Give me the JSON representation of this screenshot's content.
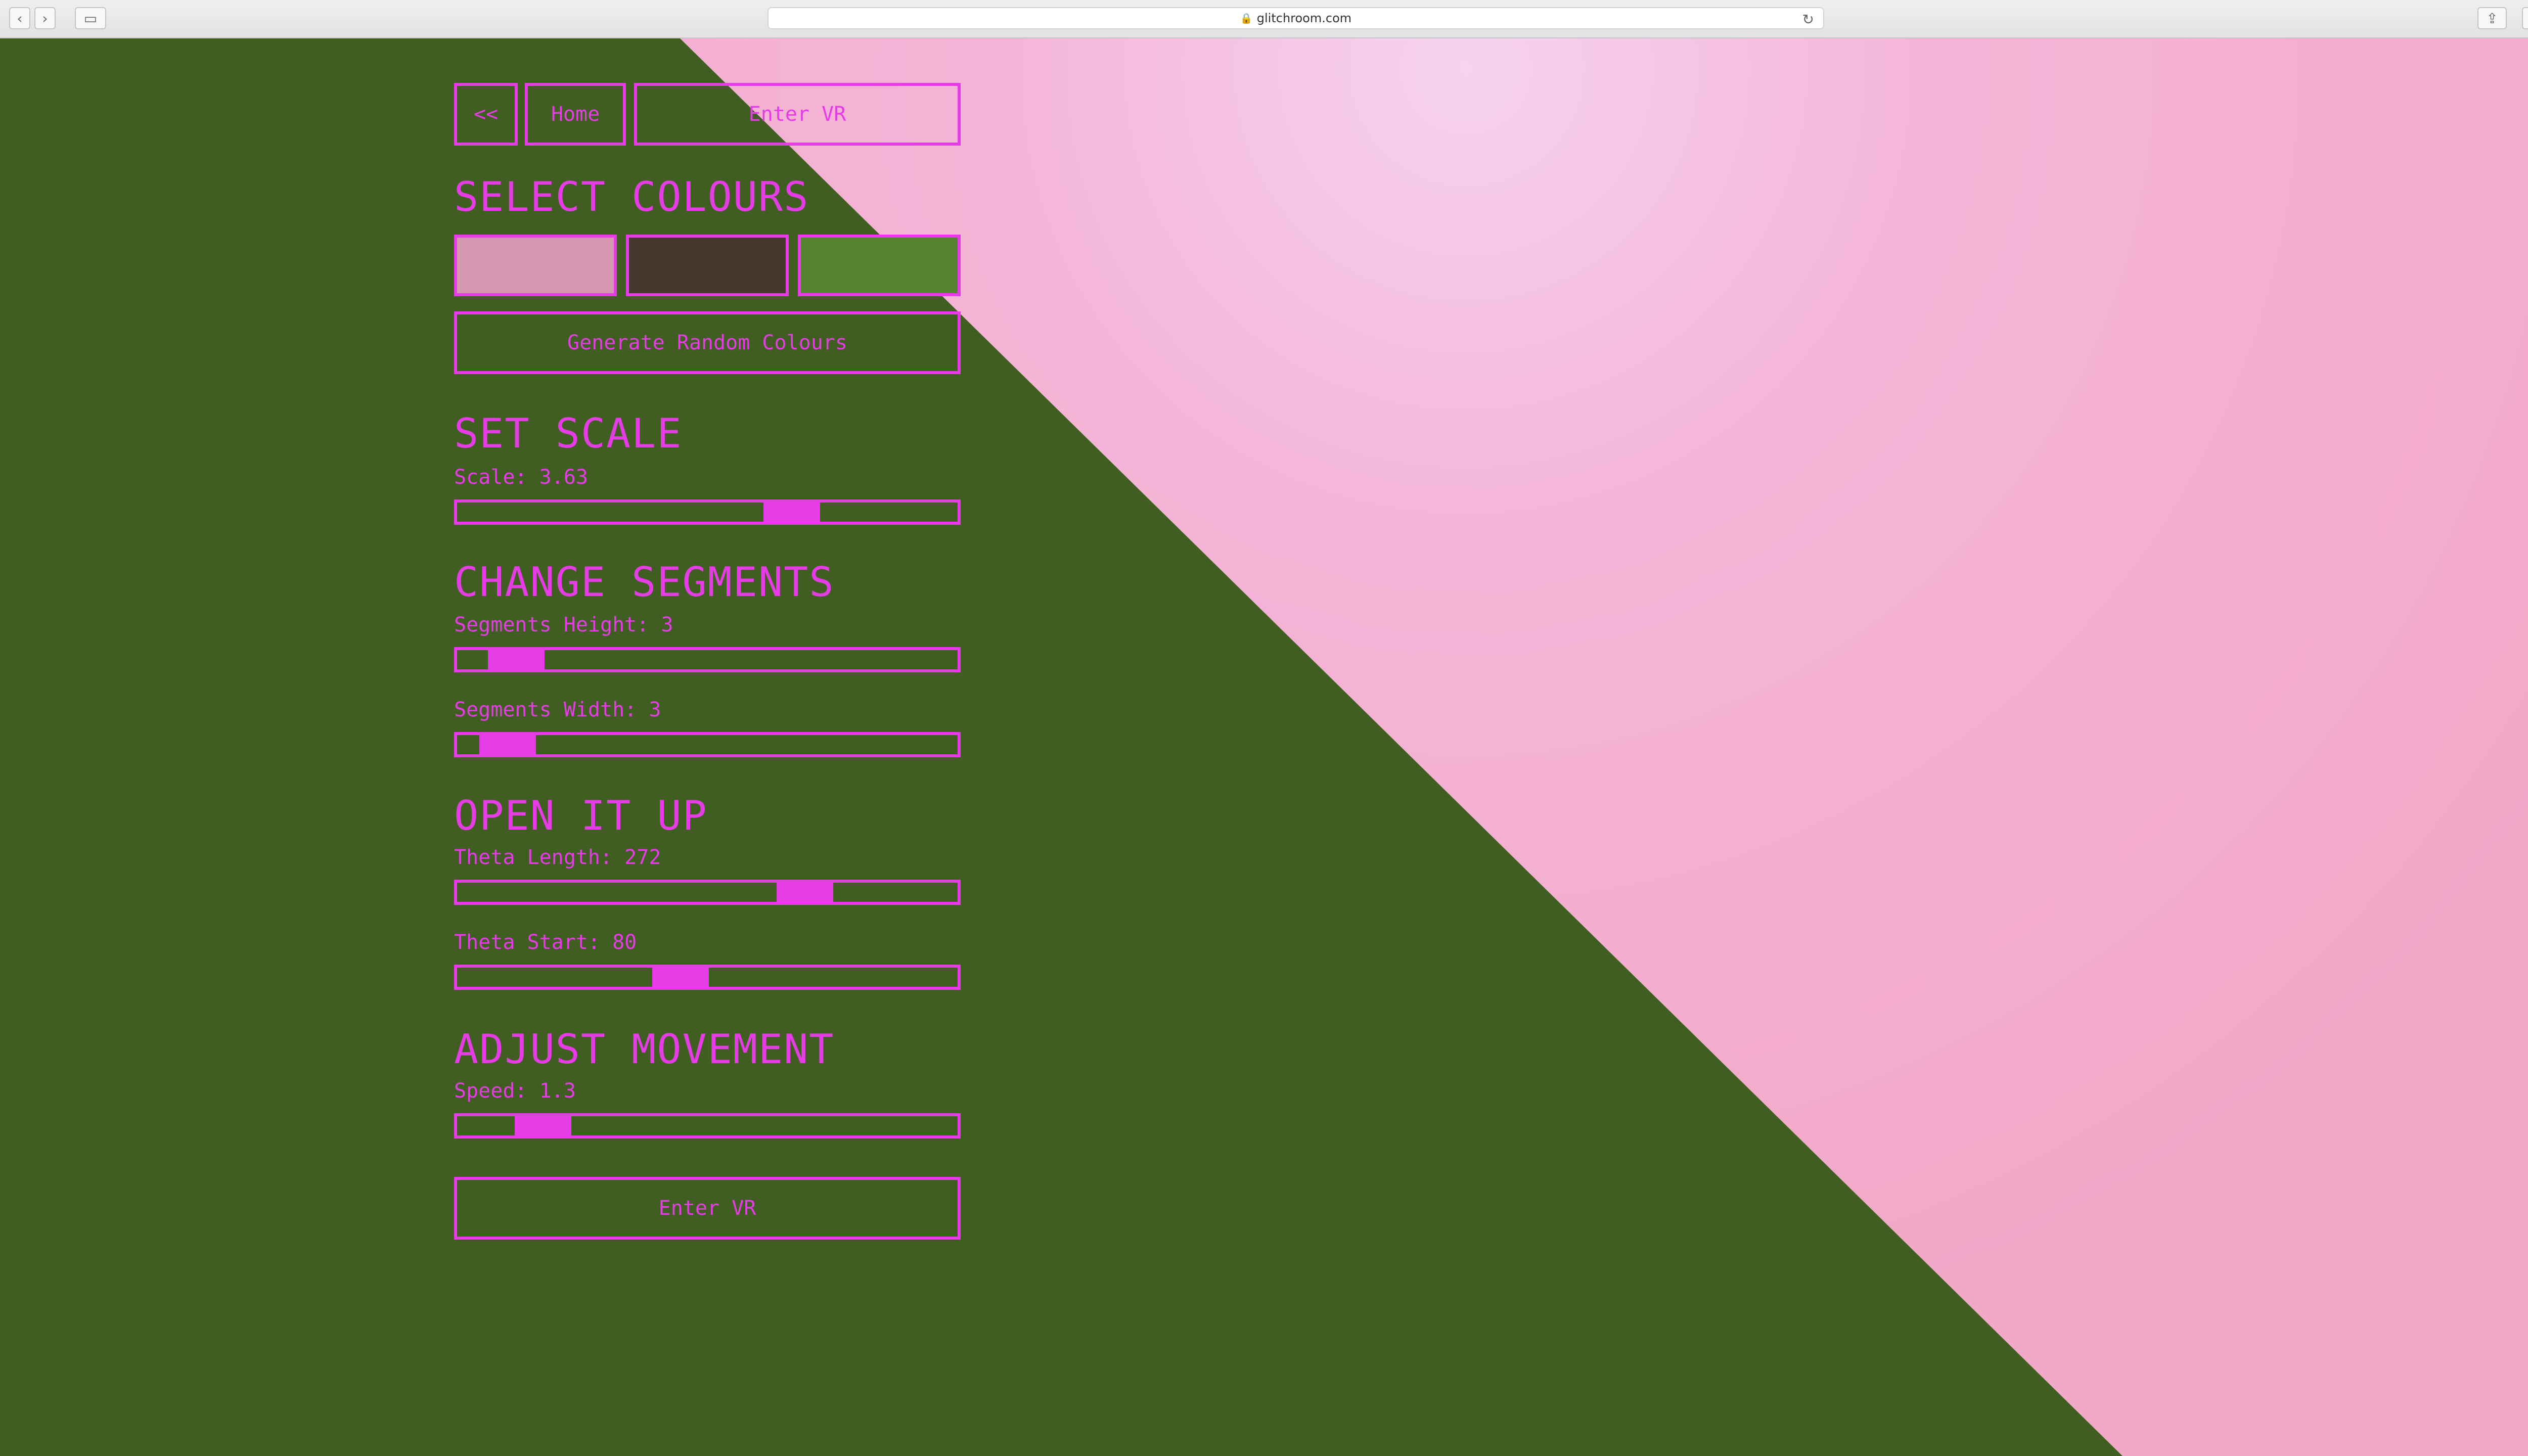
{
  "browser": {
    "url": "glitchroom.com",
    "back_icon": "‹",
    "forward_icon": "›",
    "sidebar_icon": "▭",
    "reload_icon": "↻",
    "share_icon": "⇪",
    "tabs_icon": "⧉",
    "new_tab_icon": "+"
  },
  "colors": {
    "accent": "#e63ce6",
    "background_green": "#405e21",
    "background_pink": "#f4b0d0"
  },
  "nav": {
    "back_label": "<<",
    "home_label": "Home",
    "enter_vr_label": "Enter VR"
  },
  "select_colours": {
    "heading": "SELECT COLOURS",
    "swatches": [
      "#d897b1",
      "#45392e",
      "#568432"
    ],
    "random_button": "Generate Random Colours"
  },
  "set_scale": {
    "heading": "SET SCALE",
    "scale_label": "Scale: 3.63",
    "scale_value": 3.63,
    "scale_position": 0.69
  },
  "change_segments": {
    "heading": "CHANGE SEGMENTS",
    "height_label": "Segments Height: 3",
    "height_position": 0.07,
    "width_label": "Segments Width: 3",
    "width_position": 0.05
  },
  "open_it_up": {
    "heading": "OPEN IT UP",
    "theta_length_label": "Theta Length: 272",
    "theta_length_position": 0.72,
    "theta_start_label": "Theta Start: 80",
    "theta_start_position": 0.44
  },
  "adjust_movement": {
    "heading": "ADJUST MOVEMENT",
    "speed_label": "Speed: 1.3",
    "speed_position": 0.13
  },
  "footer": {
    "enter_vr_label": "Enter VR"
  }
}
